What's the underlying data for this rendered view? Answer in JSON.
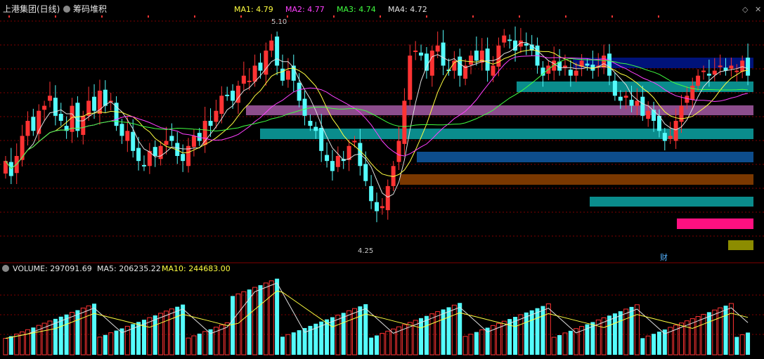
{
  "header": {
    "title": "上港集团(日线)",
    "indicator": "筹码堆积",
    "ma_items": [
      {
        "text": "MA1: 4.79",
        "color": "#ffff40"
      },
      {
        "text": "MA2: 4.77",
        "color": "#ff40ff"
      },
      {
        "text": "MA3: 4.74",
        "color": "#40ff40"
      },
      {
        "text": "MA4: 4.72",
        "color": "#e0e0e0"
      }
    ]
  },
  "volume_header": {
    "label": "VOLUME: 297091.69",
    "ma5": "MA5: 206235.22",
    "ma10": "MA10: 244683.00"
  },
  "annotations": {
    "high": "5.10",
    "low": "4.25",
    "caizhi": "财"
  },
  "colors": {
    "up": "#ff3333",
    "down": "#54fcfc",
    "grid": "#800000",
    "yellow": "#ffff40",
    "magenta": "#ff40ff",
    "green": "#40ff40",
    "white": "#e0e0e0"
  },
  "chart_data": {
    "type": "candlestick",
    "y_range": [
      4.18,
      5.16
    ],
    "candles_close": [
      4.58,
      4.52,
      4.6,
      4.68,
      4.74,
      4.7,
      4.78,
      4.8,
      4.84,
      4.76,
      4.74,
      4.7,
      4.8,
      4.7,
      4.76,
      4.82,
      4.78,
      4.86,
      4.8,
      4.82,
      4.72,
      4.68,
      4.7,
      4.62,
      4.58,
      4.56,
      4.62,
      4.6,
      4.64,
      4.66,
      4.66,
      4.6,
      4.58,
      4.64,
      4.68,
      4.66,
      4.74,
      4.72,
      4.78,
      4.84,
      4.84,
      4.82,
      4.88,
      4.92,
      4.9,
      4.96,
      4.94,
      5.02,
      5.06,
      4.96,
      4.9,
      4.94,
      4.9,
      4.82,
      4.76,
      4.72,
      4.7,
      4.62,
      4.58,
      4.54,
      4.6,
      4.58,
      4.64,
      4.66,
      4.56,
      4.5,
      4.42,
      4.38,
      4.4,
      4.48,
      4.56,
      4.66,
      4.82,
      5,
      5.02,
      5,
      4.94,
      5.02,
      5.04,
      4.96,
      4.94,
      4.98,
      4.92,
      4.96,
      5,
      4.98,
      5.02,
      4.94,
      4.96,
      5.04,
      5.08,
      5.06,
      5.02,
      5.06,
      5.04,
      5.02,
      4.96,
      4.92,
      4.96,
      4.98,
      4.94,
      4.96,
      4.92,
      4.94,
      4.98,
      4.96,
      4.94,
      4.96,
      5,
      4.92,
      4.84,
      4.82,
      4.84,
      4.8,
      4.82,
      4.76,
      4.78,
      4.74,
      4.7,
      4.66,
      4.68,
      4.74,
      4.8,
      4.84,
      4.88,
      4.92,
      4.94,
      4.92,
      4.94,
      4.96,
      4.94,
      4.96,
      4.94,
      4.98,
      4.92
    ],
    "vol_max": 290000
  }
}
